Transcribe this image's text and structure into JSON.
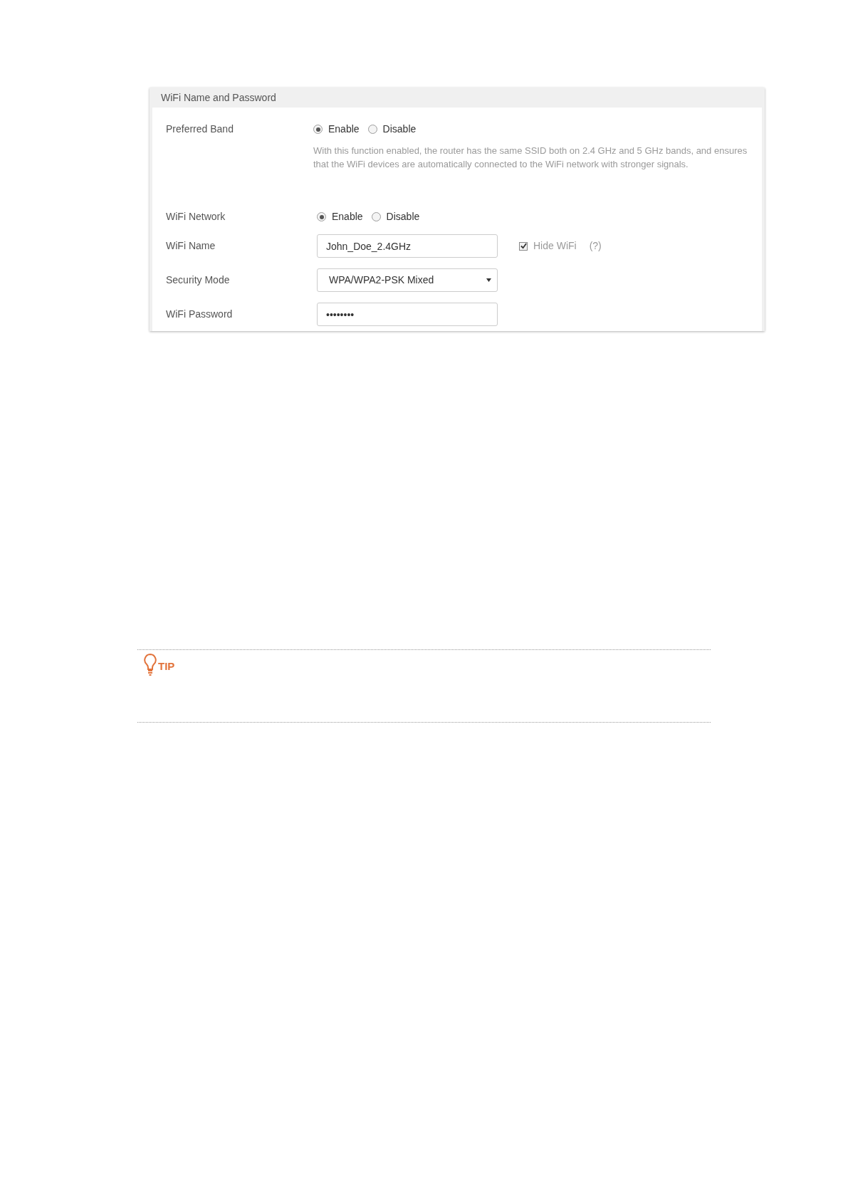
{
  "panel": {
    "title": "WiFi Name and Password",
    "rows": [
      {
        "kind": "radio",
        "label": "Preferred Band",
        "options": [
          {
            "label": "Enable",
            "selected": true
          },
          {
            "label": "Disable",
            "selected": false
          }
        ],
        "note": "With this function enabled, the router has the same SSID both on 2.4 GHz and 5 GHz bands, and ensures that the WiFi devices are automatically connected to the WiFi network with stronger signals."
      },
      {
        "kind": "radio",
        "label": "WiFi Network",
        "options": [
          {
            "label": "Enable",
            "selected": true
          },
          {
            "label": "Disable",
            "selected": false
          }
        ]
      },
      {
        "kind": "text",
        "label": "WiFi Name",
        "value": "John_Doe_2.4GHz",
        "checkbox": {
          "label": "Hide WiFi",
          "checked": true
        },
        "help": "(?)"
      },
      {
        "kind": "select",
        "label": "Security Mode",
        "value": "WPA/WPA2-PSK Mixed"
      },
      {
        "kind": "password",
        "label": "WiFi Password",
        "value": "••••••••"
      }
    ]
  },
  "tip": {
    "label": "TIP"
  }
}
